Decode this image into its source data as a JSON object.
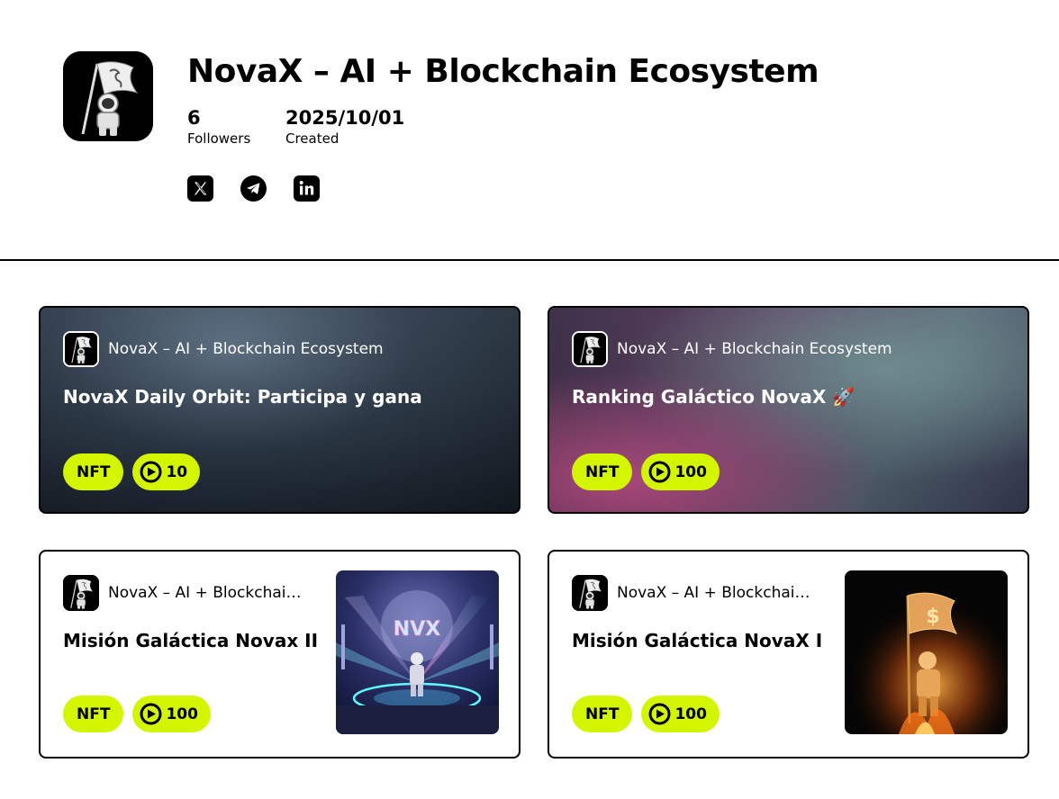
{
  "profile": {
    "name": "NovaX – AI + Blockchain Ecosystem",
    "followers_count": "6",
    "followers_label": "Followers",
    "created_date": "2025/10/01",
    "created_label": "Created",
    "socials": [
      "x-icon",
      "telegram-icon",
      "linkedin-icon"
    ]
  },
  "cards": [
    {
      "author": "NovaX – AI + Blockchain Ecosystem",
      "title": "NovaX Daily Orbit: Participa y gana",
      "tag": "NFT",
      "points": "10"
    },
    {
      "author": "NovaX – AI + Blockchain Ecosystem",
      "title": "Ranking Galáctico NovaX 🚀",
      "tag": "NFT",
      "points": "100"
    },
    {
      "author": "NovaX – AI + Blockchain Ecosystem",
      "title": "Misión Galáctica Novax II",
      "tag": "NFT",
      "points": "100",
      "thumb_text": "NVX"
    },
    {
      "author": "NovaX – AI + Blockchain Ecosystem",
      "title": "Misión Galáctica NovaX I",
      "tag": "NFT",
      "points": "100"
    }
  ],
  "colors": {
    "badge": "#d4f500",
    "text": "#000000"
  }
}
